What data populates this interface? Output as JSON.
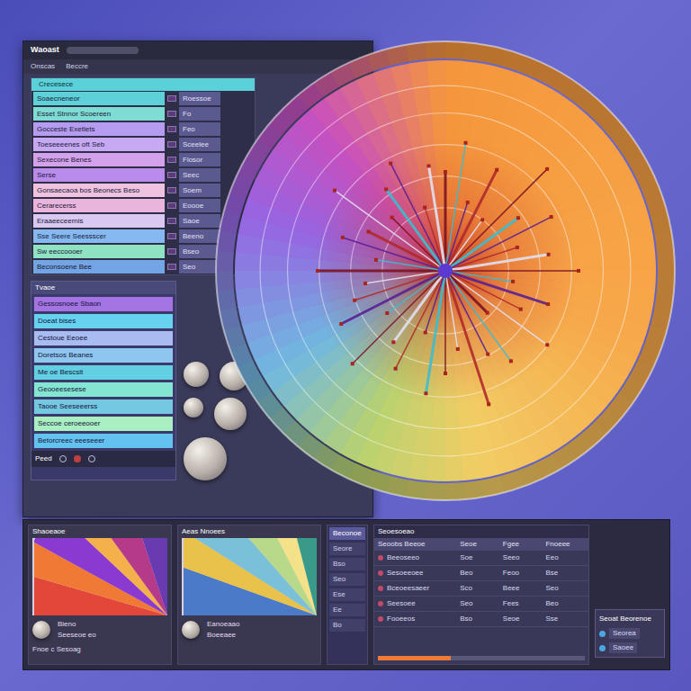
{
  "window": {
    "title": "Waoast",
    "toolbar": [
      "Onscas",
      "Beccre"
    ]
  },
  "list_header": "Crecesece",
  "list_rows": [
    {
      "label": "Soaecneneor",
      "side": "Roessoe",
      "color": "#5ed1d8"
    },
    {
      "label": "Esset Stnnor Scoereen",
      "side": "Fo",
      "color": "#7fdcd4"
    },
    {
      "label": "Gocceste Exetlets",
      "side": "Feo",
      "color": "#b59cf0"
    },
    {
      "label": "Toeseeeenes oft Seb",
      "side": "Sceelee",
      "color": "#c7a8f2"
    },
    {
      "label": "Sexecone Benes",
      "side": "Flosor",
      "color": "#d4a2ea"
    },
    {
      "label": "Serse",
      "side": "Seec",
      "color": "#b98ceb"
    },
    {
      "label": "Gonsaecaoa bos Beonecs Beso",
      "side": "Soem",
      "color": "#efc3e0"
    },
    {
      "label": "Cerarecerss",
      "side": "Eoooe",
      "color": "#eab5dc"
    },
    {
      "label": "Eraaeeceernis",
      "side": "Saoe",
      "color": "#d9c9f1"
    },
    {
      "label": "Sse Seere Seessscer",
      "side": "Beeno",
      "color": "#86b9f0"
    },
    {
      "label": "Sw eeccoooer",
      "side": "Bseo",
      "color": "#8fe3c2"
    },
    {
      "label": "Beconsoene Bee",
      "side": "Seo",
      "color": "#73a4e4"
    }
  ],
  "sub_panel": {
    "title": "Tvaoe",
    "rows": [
      {
        "label": "Gessosnoee Sbaon",
        "color": "#a374e2"
      },
      {
        "label": "Doeat bises",
        "color": "#66d2f0"
      },
      {
        "label": "Cestoue Eeoee",
        "color": "#a8bcf2"
      },
      {
        "label": "Doretsos Beanes",
        "color": "#8ec6f0"
      },
      {
        "label": "Me oe Bescsit",
        "color": "#62d0e2"
      },
      {
        "label": "Geooeesesese",
        "color": "#84e6d2"
      },
      {
        "label": "Taooe Seeseeerss",
        "color": "#74c8e2"
      },
      {
        "label": "Seccoe ceroeeooer",
        "color": "#a9efc2"
      },
      {
        "label": "Betorcreec eeeseeer",
        "color": "#64c2f0"
      }
    ],
    "footer": "Peed"
  },
  "radial_chart": {
    "rings": [
      0.3,
      0.45,
      0.6,
      0.75,
      0.88
    ],
    "rays": [
      0.55,
      0.72,
      0.4,
      0.63,
      0.35,
      0.8,
      0.5,
      0.66,
      0.42,
      0.58,
      0.74,
      0.38,
      0.6,
      0.47,
      0.7,
      0.33,
      0.62,
      0.52,
      0.78,
      0.44,
      0.57,
      0.69,
      0.36,
      0.61,
      0.49,
      0.73,
      0.4,
      0.65,
      0.53,
      0.45,
      0.71,
      0.39,
      0.6,
      0.48,
      0.76,
      0.42,
      0.56,
      0.67,
      0.37,
      0.59
    ]
  },
  "bottom": {
    "cards": [
      {
        "title": "Shaoeaoe",
        "caption": "Bieno",
        "sub": "Seeseoe eo",
        "wedges": [
          {
            "value": 18,
            "color": "#e2473a"
          },
          {
            "value": 14,
            "color": "#f07a35"
          },
          {
            "value": 16,
            "color": "#8a3ad0"
          },
          {
            "value": 12,
            "color": "#f4b04a"
          },
          {
            "value": 20,
            "color": "#b53a8a"
          },
          {
            "value": 20,
            "color": "#6a3ab0"
          }
        ]
      },
      {
        "title": "Aeas Nnoees",
        "caption": "Eanoeaao",
        "sub": "Boeeaee",
        "wedges": [
          {
            "value": 22,
            "color": "#4a7ac8"
          },
          {
            "value": 14,
            "color": "#e8c24a"
          },
          {
            "value": 18,
            "color": "#7ac0d8"
          },
          {
            "value": 16,
            "color": "#b8d88a"
          },
          {
            "value": 14,
            "color": "#f4e28a"
          },
          {
            "value": 16,
            "color": "#3a9a8a"
          }
        ]
      }
    ],
    "mini_list": {
      "title": "Beconoe",
      "items": [
        "Seore",
        "Bso",
        "Seo",
        "Ese",
        "Ee",
        "Bo"
      ]
    },
    "table": {
      "title": "Seoesoeao",
      "columns": [
        "Seoobs Beeoe",
        "Seoe",
        "Fgee",
        "Fnoeee"
      ],
      "rows": [
        [
          "Beeoseeo",
          "Soe",
          "Seeo",
          "Eeo"
        ],
        [
          "Sesoeeoee",
          "Beo",
          "Feoo",
          "Bse"
        ],
        [
          "Bceoeesaeer",
          "Sco",
          "Beee",
          "Seo"
        ],
        [
          "Seesoee",
          "Seo",
          "Fees",
          "Beo"
        ],
        [
          "Fooeeos",
          "Bso",
          "Seoe",
          "Sse"
        ]
      ],
      "progress": {
        "level": 0.35
      }
    },
    "widget": {
      "title": "Seoat Beorenoe",
      "items": [
        "Seorea",
        "Saoee"
      ]
    },
    "footer": "Fnoe c Sesoag"
  }
}
